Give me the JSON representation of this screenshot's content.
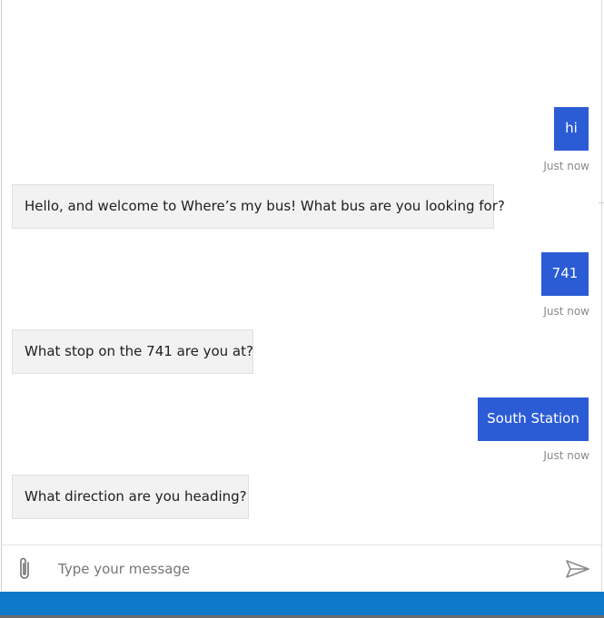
{
  "colors": {
    "user_bubble": "#2b5cd6",
    "bot_bubble": "#f2f2f2",
    "bottom_bar": "#0e78c9",
    "timestamp_text": "#8a8a8a"
  },
  "conversation": {
    "messages": [
      {
        "role": "user",
        "text": "hi",
        "timestamp": "Just now"
      },
      {
        "role": "bot",
        "text": "Hello, and welcome to Where’s my bus! What bus are you looking for?"
      },
      {
        "role": "user",
        "text": "741",
        "timestamp": "Just now"
      },
      {
        "role": "bot",
        "text": "What stop on the 741 are you at?"
      },
      {
        "role": "user",
        "text": "South Station",
        "timestamp": "Just now"
      },
      {
        "role": "bot",
        "text": "What direction are you heading?"
      }
    ]
  },
  "input": {
    "placeholder": "Type your message",
    "value": "",
    "attach_icon": "paperclip-icon",
    "send_icon": "send-icon"
  }
}
